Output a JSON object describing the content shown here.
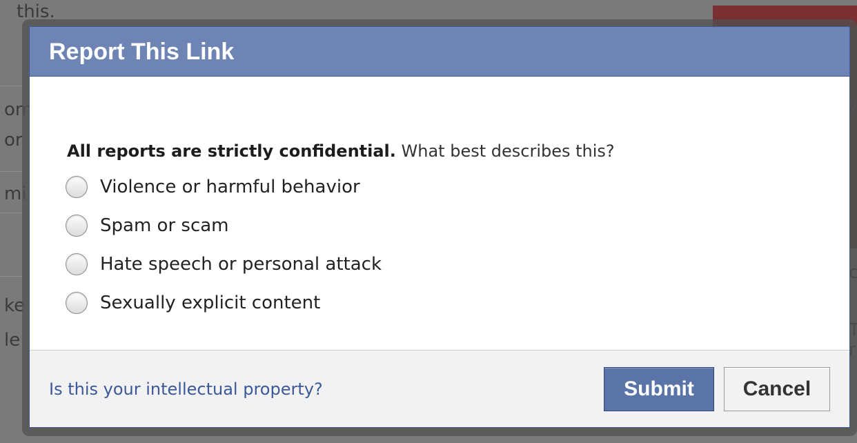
{
  "background": {
    "top_text": "this.",
    "side_fragments": [
      "om",
      "or",
      "mi",
      "ke",
      "le"
    ],
    "right_fragments": [
      "/",
      "c",
      "T",
      "r"
    ]
  },
  "dialog": {
    "title": "Report This Link",
    "prompt_bold": "All reports are strictly confidential.",
    "prompt_rest": " What best describes this?",
    "options": [
      {
        "label": "Violence or harmful behavior",
        "selected": false
      },
      {
        "label": "Spam or scam",
        "selected": false
      },
      {
        "label": "Hate speech or personal attack",
        "selected": false
      },
      {
        "label": "Sexually explicit content",
        "selected": false
      }
    ],
    "footer_link": "Is this your intellectual property?",
    "submit_label": "Submit",
    "cancel_label": "Cancel"
  },
  "colors": {
    "header": "#6d84b4",
    "submit": "#5b74a8",
    "link": "#3b5998"
  },
  "icons": {
    "radio": "radio-button-icon"
  }
}
